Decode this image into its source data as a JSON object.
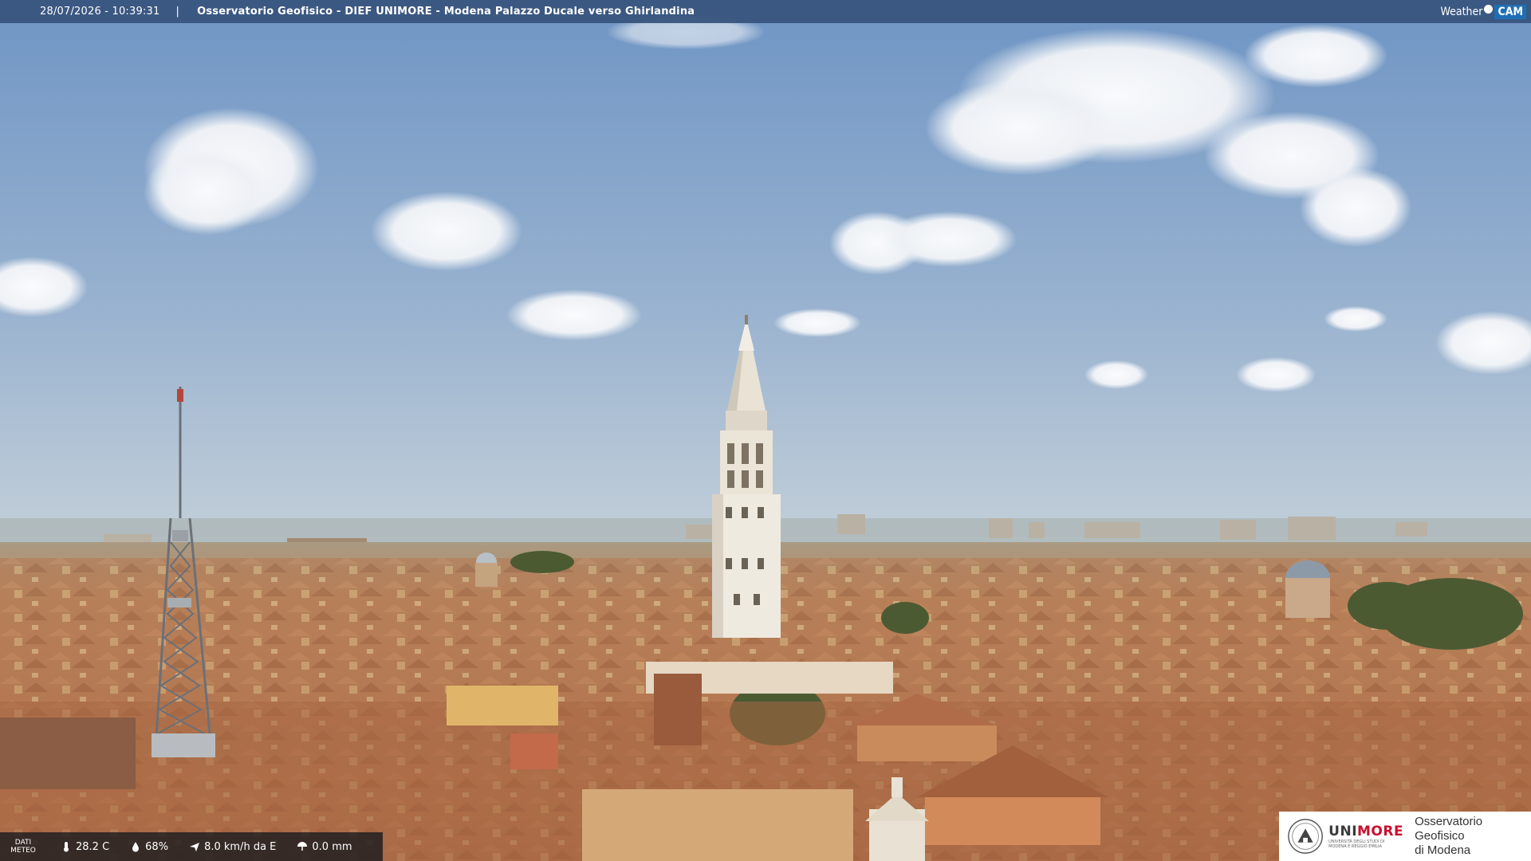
{
  "header": {
    "timestamp": "28/07/2026 - 10:39:31",
    "separator": "|",
    "title": "Osservatorio Geofisico - DIEF UNIMORE - Modena Palazzo Ducale verso Ghirlandina",
    "brand_weather": "Weather",
    "brand_cam": "CAM"
  },
  "weather": {
    "label_line1": "DATI",
    "label_line2": "METEO",
    "temperature": "28.2 C",
    "humidity": "68%",
    "wind": "8.0 km/h da E",
    "rain": "0.0 mm"
  },
  "logo": {
    "university_a": "UNI",
    "university_b": "MORE",
    "university_sub": "UNIVERSITÀ DEGLI STUDI DI MODENA E REGGIO EMILIA",
    "observatory_line1": "Osservatorio Geofisico",
    "observatory_line2": "di Modena"
  },
  "colors": {
    "sky_top": "#6f95c4",
    "sky_horizon": "#b9c8d6",
    "roof": "#b77a52",
    "bar": "#36527c",
    "accent": "#c8102e"
  },
  "icons": [
    "thermometer-icon",
    "humidity-icon",
    "wind-icon",
    "rain-icon",
    "university-crest-icon"
  ]
}
